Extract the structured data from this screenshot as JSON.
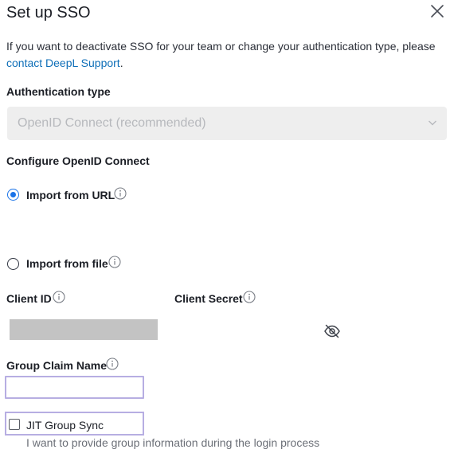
{
  "dialog": {
    "title": "Set up SSO",
    "intro_text": "If you want to deactivate SSO for your team or change your authentication type, please ",
    "support_link": "contact DeepL Support",
    "intro_end": "."
  },
  "auth_type": {
    "label": "Authentication type",
    "selected": "OpenID Connect (recommended)"
  },
  "configure": {
    "heading": "Configure OpenID Connect",
    "options": [
      {
        "label": "Import from URL",
        "selected": true
      },
      {
        "label": "Import from file",
        "selected": false
      }
    ]
  },
  "client": {
    "id_label": "Client ID",
    "secret_label": "Client Secret"
  },
  "group_claim": {
    "label": "Group Claim Name",
    "value": ""
  },
  "jit": {
    "label": "JIT Group Sync",
    "checked": false,
    "hint": "I want to provide group information during the login process"
  },
  "icons": {
    "close": "close-icon",
    "info": "info-icon",
    "chevron": "chevron-down-icon",
    "eye": "eye-off-icon"
  },
  "colors": {
    "link": "#0f6fb8",
    "radio_selected": "#1a73e8",
    "highlight_border": "#b7aee2"
  }
}
